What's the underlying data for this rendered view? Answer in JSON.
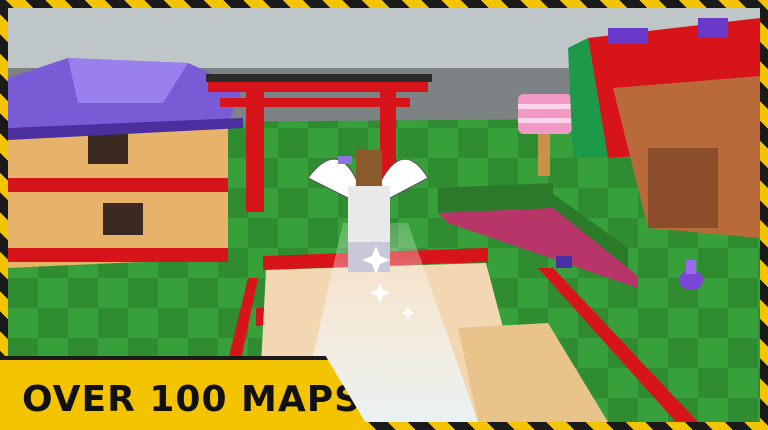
{
  "caption": {
    "text": "OVER 100 MAPS!"
  },
  "colors": {
    "stripe_yellow": "#f5c400",
    "stripe_black": "#1a1a1a",
    "grass": "#2e8a2e",
    "torii_red": "#d8141b",
    "roof_purple": "#7a5bd6"
  },
  "scene": {
    "icons": [
      "pagoda-house",
      "torii-gate",
      "cherry-lantern",
      "dragon-structure",
      "hedge-wall",
      "player-avatar",
      "sparkle-effect",
      "potion-vase"
    ]
  }
}
